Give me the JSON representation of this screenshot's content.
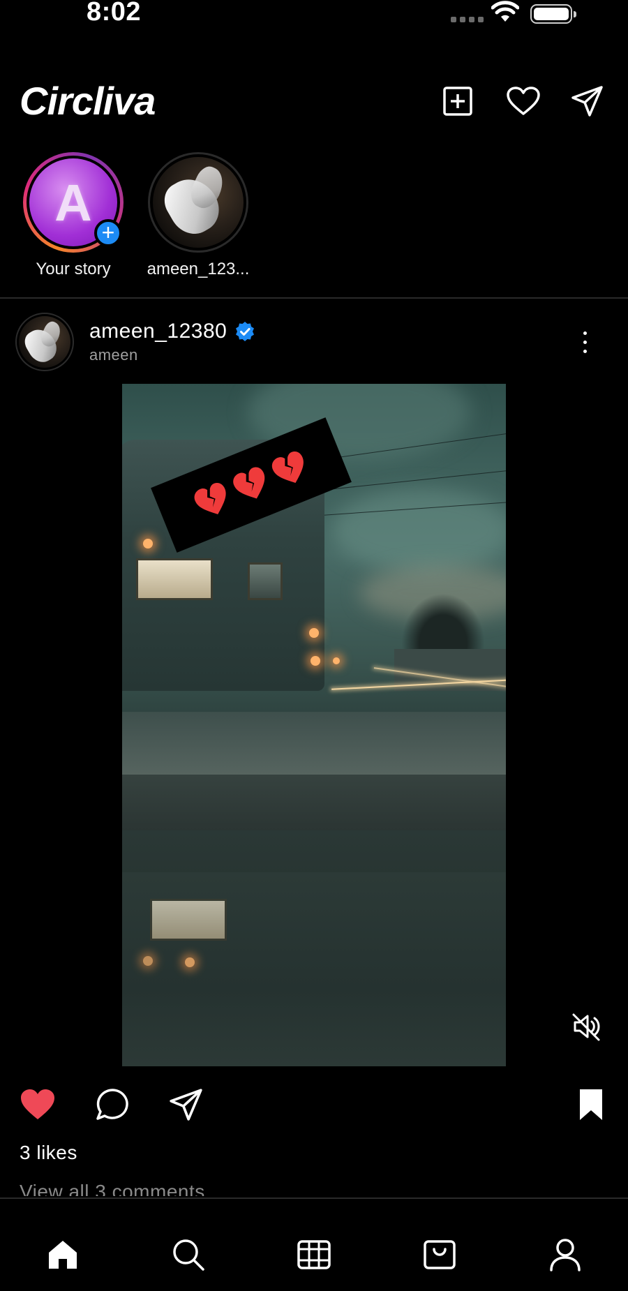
{
  "status_bar": {
    "time": "8:02"
  },
  "header": {
    "app_name": "Circliva",
    "icons": [
      "add-post-icon",
      "heart-icon",
      "send-icon"
    ]
  },
  "stories": [
    {
      "label": "Your story",
      "avatar_letter": "A",
      "has_add_badge": true
    },
    {
      "label": "ameen_123..."
    }
  ],
  "post": {
    "username": "ameen_12380",
    "verified": true,
    "subtitle": "ameen",
    "sticker_emoji": [
      "💔",
      "💔",
      "💔"
    ],
    "liked": true,
    "saved": true,
    "muted": true,
    "likes_text": "3 likes",
    "comments_link": "View all 3 comments"
  },
  "bottom_nav": {
    "items": [
      "home-icon",
      "search-icon",
      "reels-icon",
      "shop-icon",
      "profile-icon"
    ],
    "active": "home-icon"
  },
  "colors": {
    "background": "#000000",
    "accent_blue": "#1c8bf5",
    "like_red": "#ef4957",
    "secondary_text": "#a0a0a0"
  }
}
